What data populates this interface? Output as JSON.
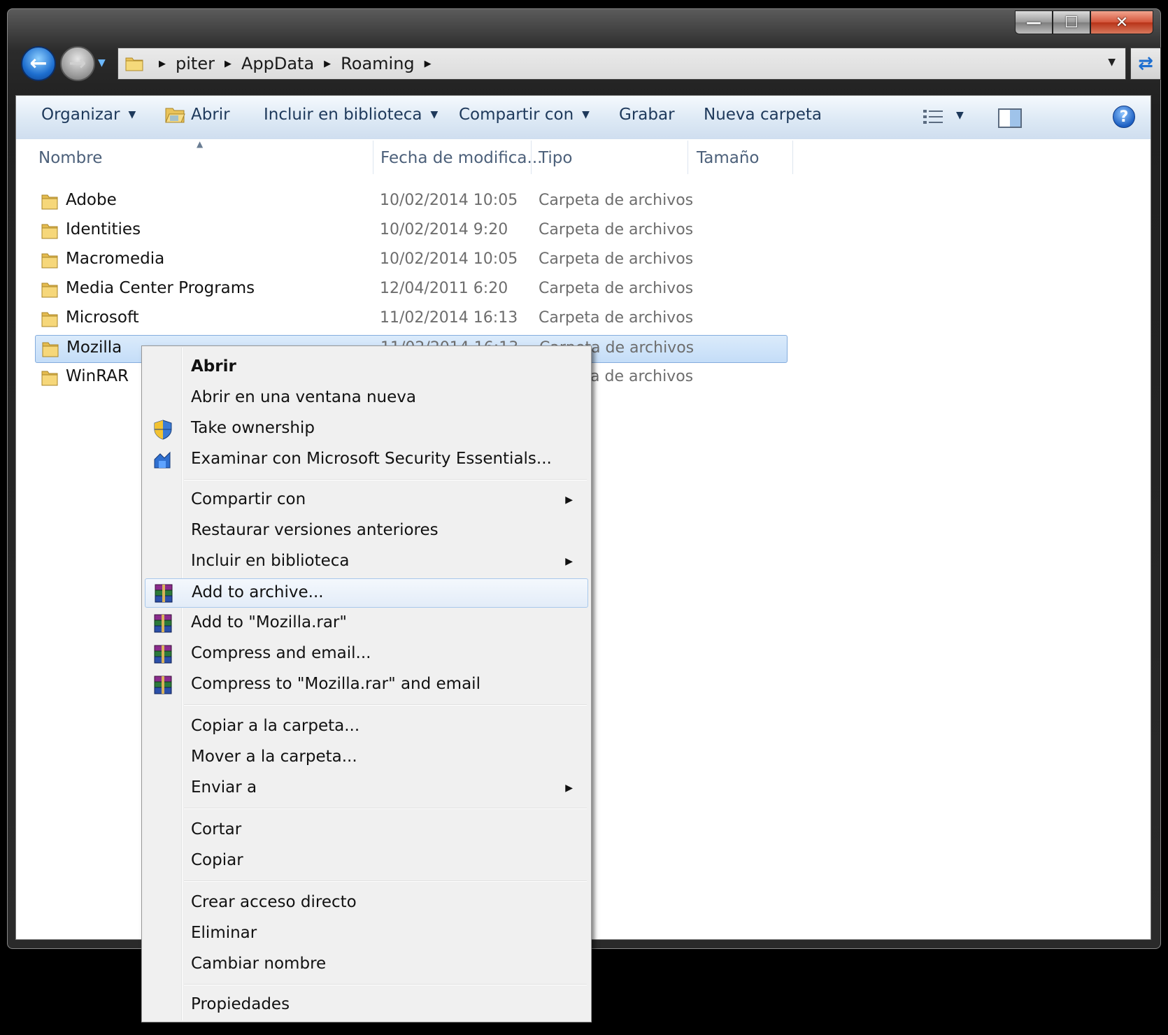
{
  "window": {
    "controls": {
      "minimize": "—",
      "maximize": "☐",
      "close": "✕"
    }
  },
  "address": {
    "crumbs": [
      "piter",
      "AppData",
      "Roaming"
    ]
  },
  "toolbar": {
    "organize": "Organizar",
    "open": "Abrir",
    "include_library": "Incluir en biblioteca",
    "share_with": "Compartir con",
    "burn": "Grabar",
    "new_folder": "Nueva carpeta",
    "help": "?"
  },
  "columns": {
    "name": "Nombre",
    "date": "Fecha de modifica...",
    "type": "Tipo",
    "size": "Tamaño"
  },
  "files": [
    {
      "name": "Adobe",
      "date": "10/02/2014 10:05",
      "type": "Carpeta de archivos"
    },
    {
      "name": "Identities",
      "date": "10/02/2014 9:20",
      "type": "Carpeta de archivos"
    },
    {
      "name": "Macromedia",
      "date": "10/02/2014 10:05",
      "type": "Carpeta de archivos"
    },
    {
      "name": "Media Center Programs",
      "date": "12/04/2011 6:20",
      "type": "Carpeta de archivos"
    },
    {
      "name": "Microsoft",
      "date": "11/02/2014 16:13",
      "type": "Carpeta de archivos"
    },
    {
      "name": "Mozilla",
      "date": "11/02/2014 16:13",
      "type": "Carpeta de archivos",
      "selected": true
    },
    {
      "name": "WinRAR",
      "date": "",
      "type": "Carpeta de archivos"
    }
  ],
  "context_menu": {
    "items": [
      {
        "label": "Abrir",
        "bold": true
      },
      {
        "label": "Abrir en una ventana nueva"
      },
      {
        "label": "Take ownership",
        "icon": "uac-shield-icon"
      },
      {
        "label": "Examinar con Microsoft Security Essentials...",
        "icon": "security-essentials-icon"
      },
      {
        "label": "Compartir con",
        "submenu": true
      },
      {
        "label": "Restaurar versiones anteriores"
      },
      {
        "label": "Incluir en biblioteca",
        "submenu": true
      },
      {
        "label": "Add to archive...",
        "icon": "winrar-icon",
        "hover": true
      },
      {
        "label": "Add to \"Mozilla.rar\"",
        "icon": "winrar-icon"
      },
      {
        "label": "Compress and email...",
        "icon": "winrar-icon"
      },
      {
        "label": "Compress to \"Mozilla.rar\" and email",
        "icon": "winrar-icon"
      },
      {
        "label": "Copiar a la carpeta..."
      },
      {
        "label": "Mover a la carpeta..."
      },
      {
        "label": "Enviar a",
        "submenu": true
      },
      {
        "label": "Cortar"
      },
      {
        "label": "Copiar"
      },
      {
        "label": "Crear acceso directo"
      },
      {
        "label": "Eliminar"
      },
      {
        "label": "Cambiar nombre"
      },
      {
        "label": "Propiedades"
      }
    ]
  },
  "colors": {
    "selection": "#c4ddf8",
    "command_text": "#1e395b",
    "menu_bg": "#f0f0f0"
  }
}
